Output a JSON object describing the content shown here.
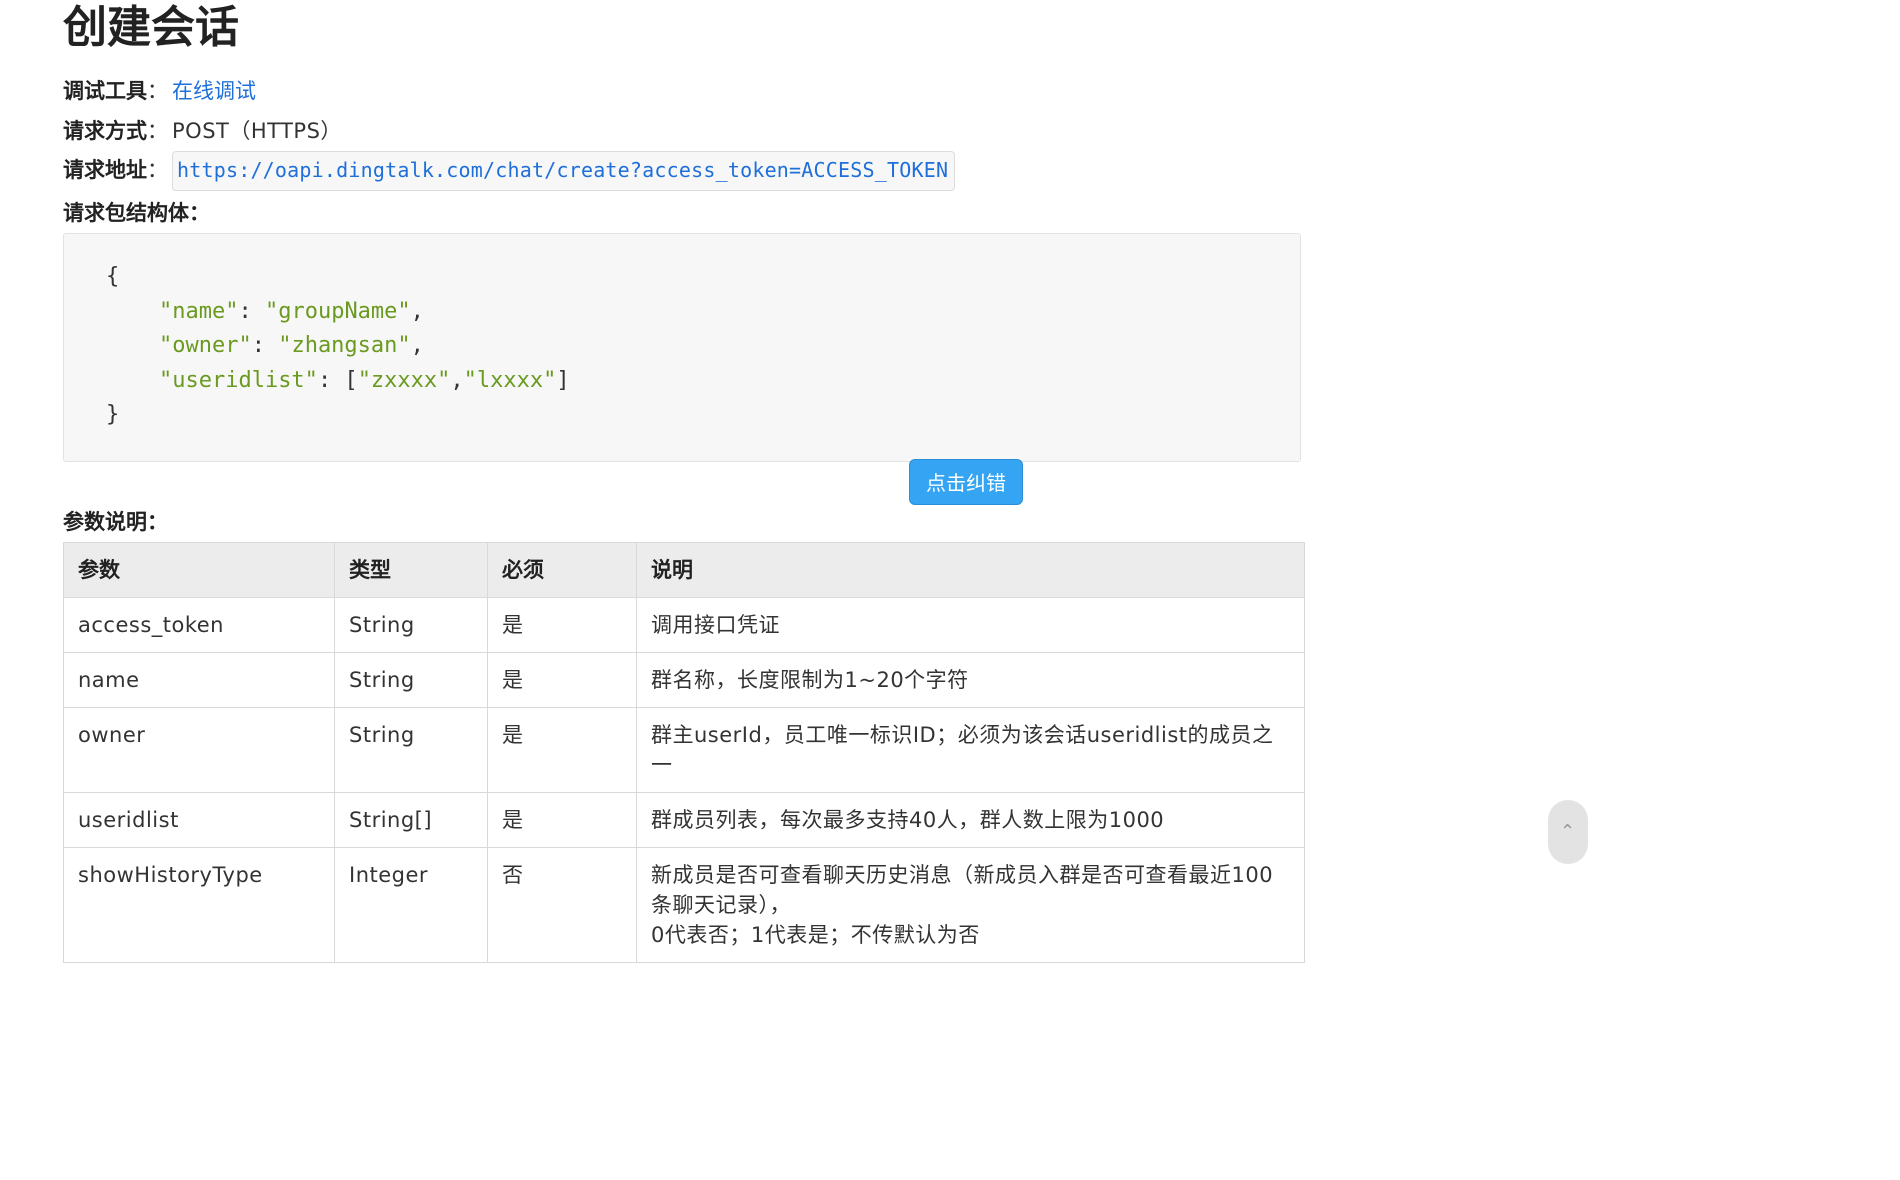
{
  "title": "创建会话",
  "meta": {
    "debug_label": "调试工具",
    "debug_link": "在线调试",
    "method_label": "请求方式",
    "method_value": "POST（HTTPS）",
    "url_label": "请求地址",
    "url_value": "https://oapi.dingtalk.com/chat/create?access_token=ACCESS_TOKEN",
    "colon": "："
  },
  "body_label": "请求包结构体：",
  "code": {
    "open_brace": "{",
    "line1_key": "\"name\"",
    "line1_val": "\"groupName\"",
    "line2_key": "\"owner\"",
    "line2_val": "\"zhangsan\"",
    "line3_key": "\"useridlist\"",
    "line3_val1": "\"zxxxx\"",
    "line3_val2": "\"lxxxx\"",
    "close_brace": "}"
  },
  "fix_button": "点击纠错",
  "params_label": "参数说明：",
  "table": {
    "headers": [
      "参数",
      "类型",
      "必须",
      "说明"
    ],
    "rows": [
      {
        "param": "access_token",
        "type": "String",
        "required": "是",
        "desc": "调用接口凭证"
      },
      {
        "param": "name",
        "type": "String",
        "required": "是",
        "desc": "群名称，长度限制为1~20个字符"
      },
      {
        "param": "owner",
        "type": "String",
        "required": "是",
        "desc": "群主userId，员工唯一标识ID；必须为该会话useridlist的成员之一"
      },
      {
        "param": "useridlist",
        "type": "String[]",
        "required": "是",
        "desc": "群成员列表，每次最多支持40人，群人数上限为1000"
      },
      {
        "param": "showHistoryType",
        "type": "Integer",
        "required": "否",
        "desc": "新成员是否可查看聊天历史消息（新成员入群是否可查看最近100条聊天记录），",
        "desc2": "0代表否；1代表是；不传默认为否"
      }
    ]
  },
  "icons": {
    "scroll_nub": "chevron-up-icon"
  }
}
